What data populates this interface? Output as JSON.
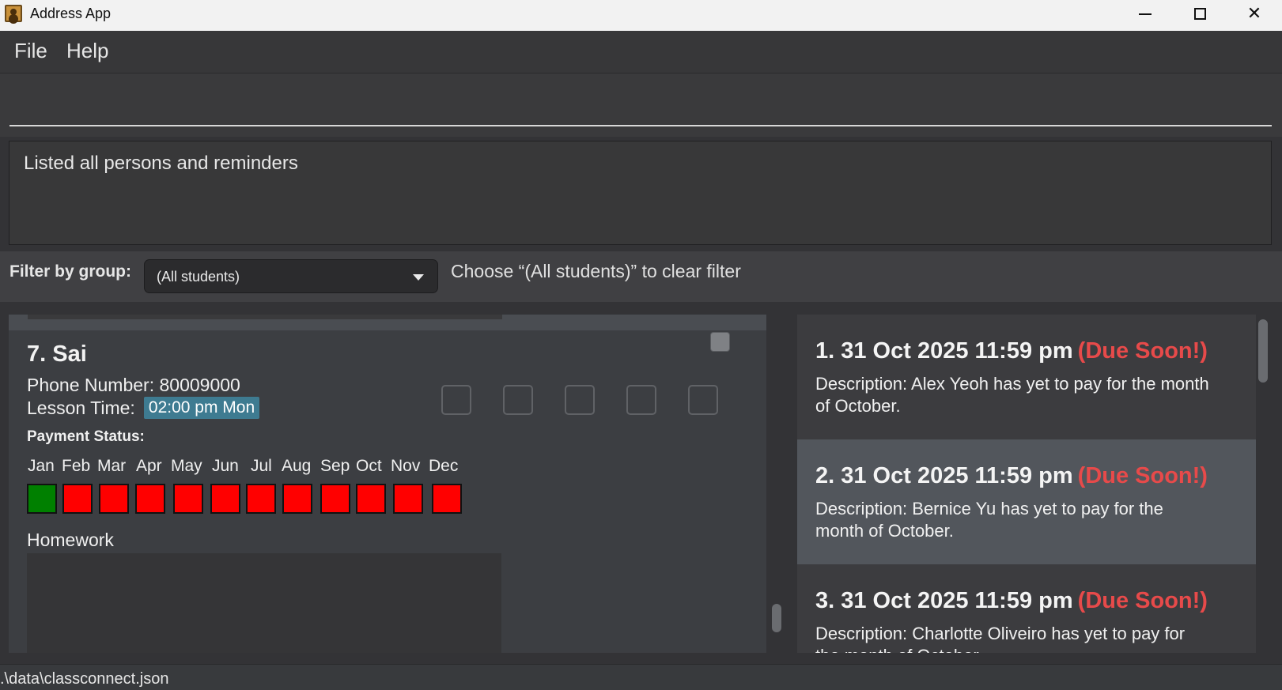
{
  "window": {
    "title": "Address App"
  },
  "menu": {
    "file": "File",
    "help": "Help"
  },
  "command": {
    "value": "",
    "placeholder": ""
  },
  "result": {
    "message": "Listed all persons and reminders"
  },
  "filter": {
    "label": "Filter by group:",
    "selected": "(All students)",
    "hint": "Choose “(All students)” to clear filter"
  },
  "person": {
    "name": "7. Sai",
    "phone": "Phone Number: 80009000",
    "lesson_label": "Lesson Time:",
    "lesson_time": "02:00 pm Mon",
    "payment_title": "Payment Status:",
    "months": [
      "Jan",
      "Feb",
      "Mar",
      "Apr",
      "May",
      "Jun",
      "Jul",
      "Aug",
      "Sep",
      "Oct",
      "Nov",
      "Dec"
    ],
    "paid": [
      true,
      false,
      false,
      false,
      false,
      false,
      false,
      false,
      false,
      false,
      false,
      false
    ],
    "homework_label": "Homework"
  },
  "colors": {
    "paid": "#008000",
    "unpaid": "#ff0000",
    "due": "#e74a4a",
    "lesson_tag": "#3e7b91"
  },
  "reminders": [
    {
      "title": "1. 31 Oct 2025 11:59 pm",
      "due": "(Due Soon!)",
      "description": "Description: Alex Yeoh has yet to pay for the month of October."
    },
    {
      "title": "2. 31 Oct 2025 11:59 pm",
      "due": "(Due Soon!)",
      "description": "Description: Bernice Yu has yet to pay for the month of October."
    },
    {
      "title": "3. 31 Oct 2025 11:59 pm",
      "due": "(Due Soon!)",
      "description": "Description: Charlotte Oliveiro has yet to pay for the month of October."
    }
  ],
  "status": {
    "path": ".\\data\\classconnect.json"
  }
}
